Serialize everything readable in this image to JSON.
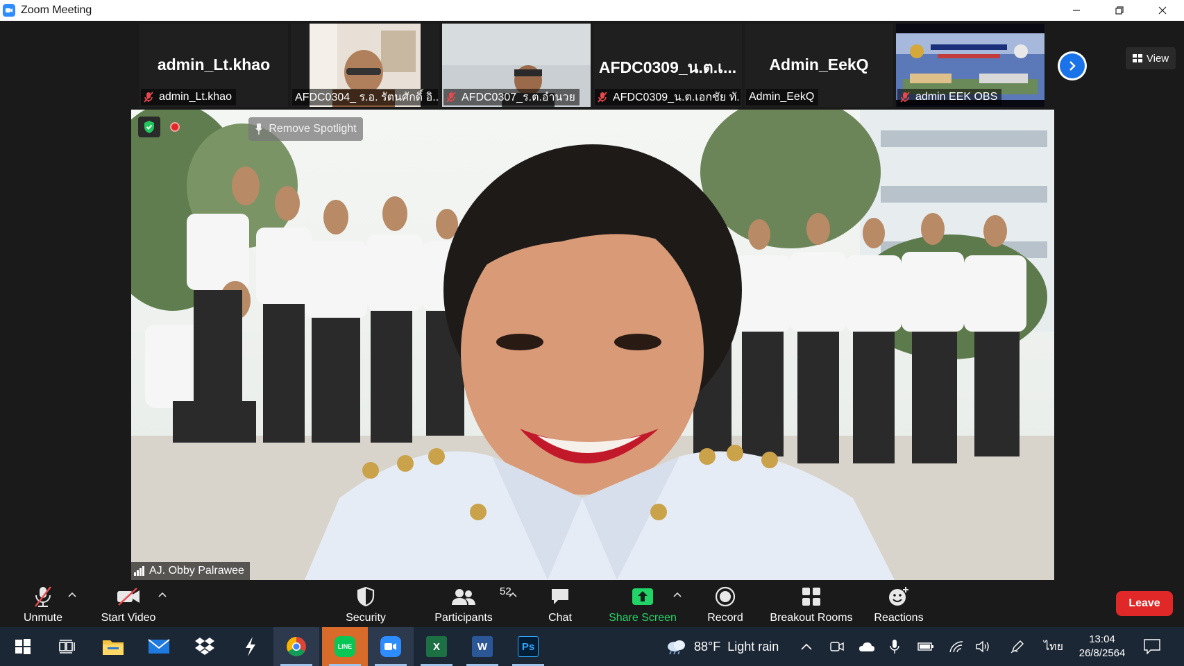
{
  "window": {
    "title": "Zoom Meeting",
    "controls": [
      "minimize",
      "restore",
      "close"
    ]
  },
  "participants_strip": [
    {
      "big_name": "admin_Lt.khao",
      "label": "admin_Lt.khao",
      "muted": true,
      "has_video": false
    },
    {
      "big_name": "",
      "label": "AFDC0304_ ร.อ. รัตนศักดิ์  อิ...",
      "muted": false,
      "has_video": true
    },
    {
      "big_name": "",
      "label": "AFDC0307_ร.ต.อำนวย",
      "muted": true,
      "has_video": true
    },
    {
      "big_name": "AFDC0309_น.ต.เ...",
      "label": "AFDC0309_น.ต.เอกชัย ทั...",
      "muted": true,
      "has_video": false
    },
    {
      "big_name": "Admin_EekQ",
      "label": "Admin_EekQ",
      "muted": false,
      "has_video": false
    },
    {
      "big_name": "",
      "label": "admin EEK OBS",
      "muted": true,
      "has_video": true
    }
  ],
  "view_button": "View",
  "main_video": {
    "spotlight_button": "Remove Spotlight",
    "speaker_name": "AJ. Obby Palrawee"
  },
  "toolbar": {
    "unmute": "Unmute",
    "start_video": "Start Video",
    "security": "Security",
    "participants": "Participants",
    "participants_count": "52",
    "chat": "Chat",
    "share_screen": "Share Screen",
    "record": "Record",
    "breakout_rooms": "Breakout Rooms",
    "reactions": "Reactions",
    "leave": "Leave"
  },
  "taskbar": {
    "weather_temp": "88°F",
    "weather_desc": "Light rain",
    "language": "ไทย",
    "time": "13:04",
    "date": "26/8/2564",
    "apps": [
      "start",
      "task-view",
      "file-explorer",
      "mail",
      "dropbox",
      "bolt-app",
      "chrome",
      "line",
      "zoom",
      "excel",
      "word",
      "photoshop"
    ]
  },
  "colors": {
    "zoom_blue": "#2d8cff",
    "share_green": "#22d468",
    "leave_red": "#e02828",
    "mute_red": "#e5484d"
  }
}
